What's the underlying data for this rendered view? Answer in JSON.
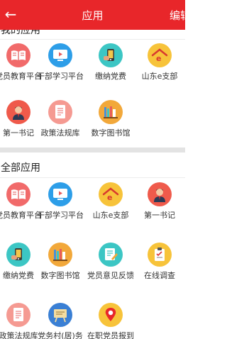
{
  "header": {
    "back_glyph": "←",
    "title": "应用",
    "edit_label": "编辑"
  },
  "my_apps": {
    "title": "我的应用",
    "items": [
      {
        "label": "党员教育平台",
        "icon": "book-icon",
        "color": "#f16a6a"
      },
      {
        "label": "干部学习平台",
        "icon": "tv-play-icon",
        "color": "#2d9ee8"
      },
      {
        "label": "缴纳党费",
        "icon": "phone-payment-icon",
        "color": "#3cc6c4"
      },
      {
        "label": "山东e支部",
        "icon": "house-e-icon",
        "color": "#f7c33a"
      },
      {
        "label": "第一书记",
        "icon": "person-icon",
        "color": "#ef5a4b"
      },
      {
        "label": "政策法规库",
        "icon": "document-icon",
        "color": "#f59a92"
      },
      {
        "label": "数字图书馆",
        "icon": "bookshelf-icon",
        "color": "#f2a83a"
      }
    ]
  },
  "all_apps": {
    "title": "全部应用",
    "items": [
      {
        "label": "党员教育平台",
        "icon": "book-icon",
        "color": "#f16a6a"
      },
      {
        "label": "干部学习平台",
        "icon": "tv-play-icon",
        "color": "#2d9ee8"
      },
      {
        "label": "山东e支部",
        "icon": "house-e-icon",
        "color": "#f7c33a"
      },
      {
        "label": "第一书记",
        "icon": "person-icon",
        "color": "#ef5a4b"
      },
      {
        "label": "缴纳党费",
        "icon": "phone-payment-icon",
        "color": "#3cc6c4"
      },
      {
        "label": "数字图书馆",
        "icon": "bookshelf-icon",
        "color": "#f2a83a"
      },
      {
        "label": "党员意见反馈",
        "icon": "feedback-edit-icon",
        "color": "#3cc6c4"
      },
      {
        "label": "在线调查",
        "icon": "survey-clipboard-icon",
        "color": "#f7c33a"
      },
      {
        "label": "政策法规库",
        "icon": "document-icon",
        "color": "#f59a92"
      },
      {
        "label": "党务村(居)务公开",
        "icon": "board-icon",
        "color": "#3a7fd4"
      },
      {
        "label": "在职党员报到",
        "icon": "location-pin-icon",
        "color": "#f7c33a"
      }
    ]
  },
  "colors": {
    "header_bg": "#e8262a",
    "divider": "#e3e3e3"
  }
}
